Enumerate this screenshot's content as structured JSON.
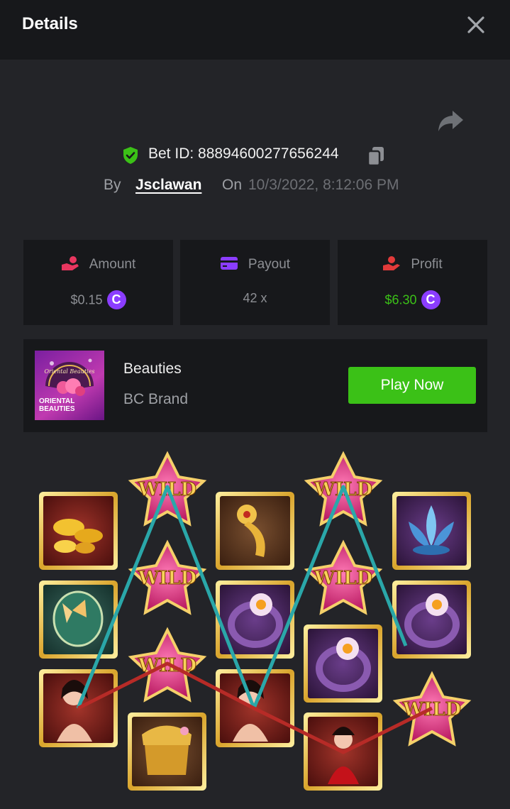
{
  "header": {
    "title": "Details"
  },
  "bet": {
    "id_text": "Bet ID: 88894600277656244",
    "by_label": "By",
    "username": "Jsclawan",
    "on_label": "On",
    "datetime": "10/3/2022, 8:12:06 PM"
  },
  "stats": [
    {
      "label": "Amount",
      "value": "$0.15",
      "icon": "amount-icon",
      "coin": "C"
    },
    {
      "label": "Payout",
      "value": "42 x",
      "icon": "payout-card-icon"
    },
    {
      "label": "Profit",
      "value": "$6.30",
      "icon": "profit-hand-icon",
      "coin": "C"
    }
  ],
  "game": {
    "name": "Beauties",
    "brand": "BC Brand",
    "play_label": "Play Now",
    "thumb_text_line1": "ORIENTAL",
    "thumb_text_line2": "BEAUTIES",
    "thumb_logo_text": "Oriental Beauties"
  },
  "reels": {
    "wild_label": "WILD",
    "columns": [
      [
        "gold-ingots-symbol",
        "fan-butterfly-symbol",
        "lady-symbol"
      ],
      [
        "wild-symbol",
        "wild-symbol",
        "wild-symbol",
        "comb-symbol"
      ],
      [
        "jade-ruyi-symbol",
        "ring-symbol",
        "lady-symbol"
      ],
      [
        "wild-symbol",
        "wild-symbol",
        "ring-symbol",
        "dancer-symbol"
      ],
      [
        "blue-lotus-symbol",
        "ring-symbol",
        "wild-symbol"
      ]
    ],
    "winning_lines": [
      {
        "color": "#2aa7a9"
      },
      {
        "color": "#b72b27"
      }
    ]
  },
  "colors": {
    "accent_green": "#3bc117",
    "coin_purple": "#8b3dff",
    "panel_bg": "#17181b",
    "page_bg": "#232428",
    "amount_icon": "#e8365f",
    "payout_icon": "#8b3dff",
    "profit_icon": "#e23a3a"
  }
}
